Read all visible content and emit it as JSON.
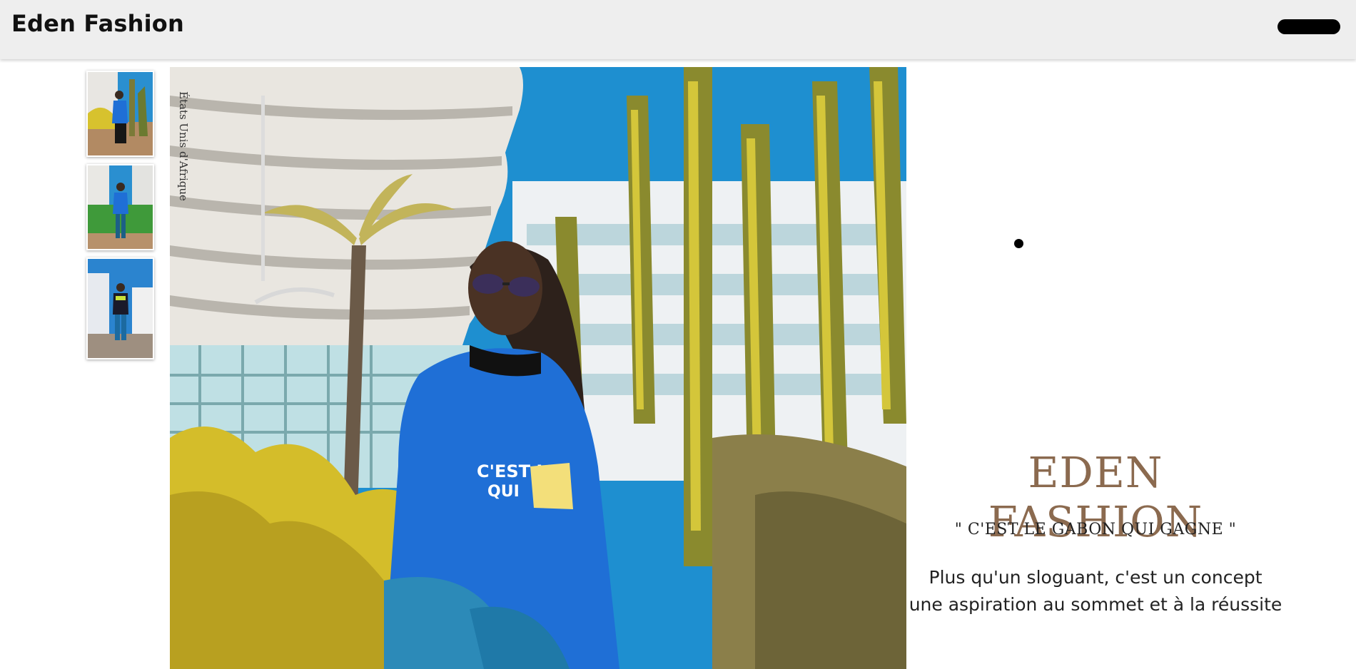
{
  "header": {
    "brand": "Eden Fashion",
    "menu_icon": "menu-pill-icon"
  },
  "gallery": {
    "thumbnails": [
      {
        "label": "thumbnail-1",
        "scene": "blue hoodie, palm trees and building"
      },
      {
        "label": "thumbnail-2",
        "scene": "blue hoodie, green hedge"
      },
      {
        "label": "thumbnail-3",
        "scene": "dark hoodie, modern building"
      }
    ],
    "hero_caption": "États Unis d'Afrique"
  },
  "content": {
    "title": "EDEN FASHION",
    "slogan": "\" C'EST LE GABON QUI GAGNE \"",
    "description_line1": "Plus qu'un sloguant, c'est un concept",
    "description_line2": "une aspiration au sommet et à la réussite"
  },
  "colors": {
    "header_bg": "#eeeeee",
    "title": "#8b6a4f",
    "accent_blue": "#1f6fd6",
    "sky": "#1e8fd0",
    "foliage": "#d4bd2a"
  }
}
